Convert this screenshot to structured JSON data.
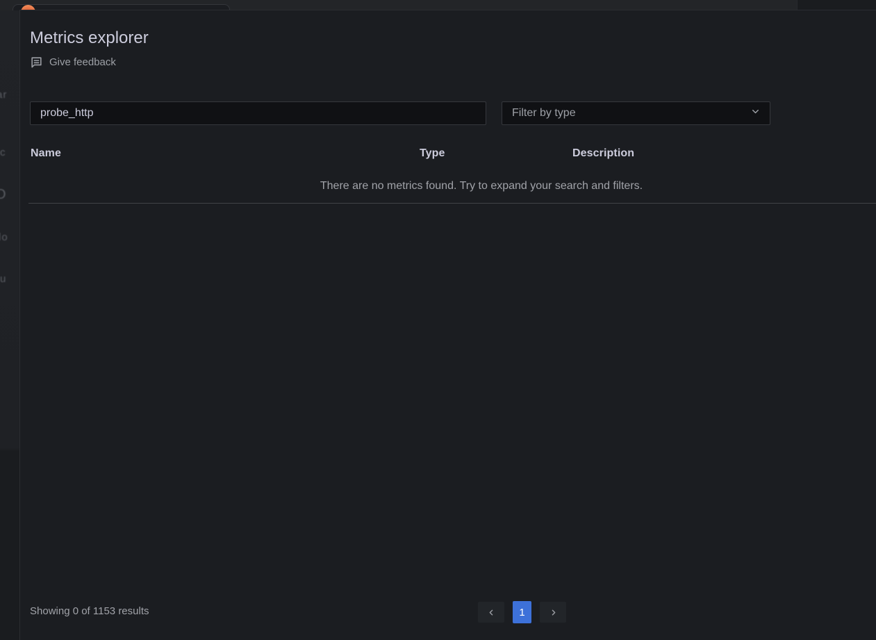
{
  "page": {
    "background": {
      "left_edge_fragments": [
        "ar",
        "c",
        "O",
        "lo",
        "u"
      ]
    }
  },
  "drawer": {
    "title": "Metrics explorer",
    "feedback": {
      "label": "Give feedback"
    },
    "search": {
      "value": "probe_http"
    },
    "type_filter": {
      "placeholder": "Filter by type"
    },
    "table": {
      "headers": [
        {
          "label": "Name"
        },
        {
          "label": "Type"
        },
        {
          "label": "Description"
        }
      ],
      "rows": [],
      "empty_message": "There are no metrics found. Try to expand your search and filters."
    },
    "footer": {
      "results_summary": "Showing 0 of 1153 results",
      "pagination": {
        "current_page": "1"
      }
    }
  },
  "colors": {
    "accent_blue": "#3d71d9",
    "drawer_background": "#1b1d21",
    "text_primary": "#ccccdc",
    "text_secondary": "#9da0a6",
    "logo_orange": "#d9572f"
  }
}
